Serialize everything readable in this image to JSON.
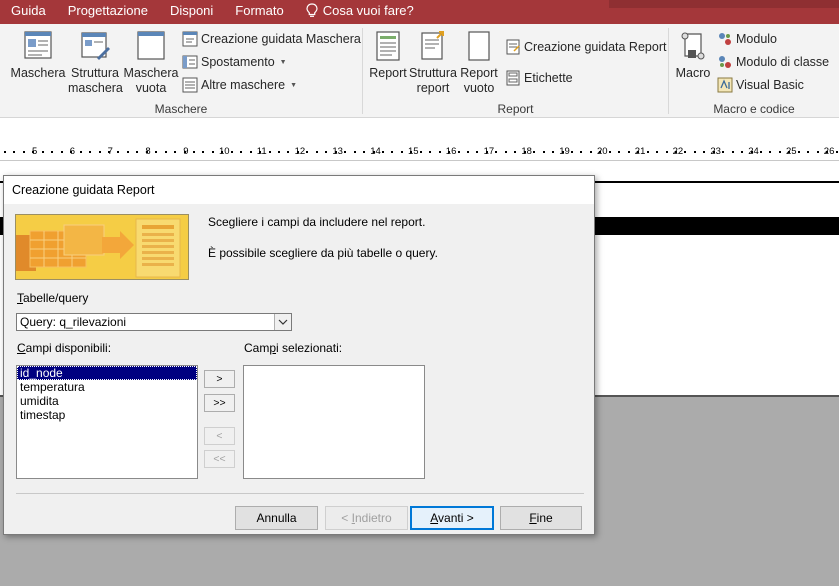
{
  "tabs": [
    "Guida",
    "Progettazione",
    "Disponi",
    "Formato"
  ],
  "tell_me": "Cosa vuoi fare?",
  "ribbon": {
    "forms_group": {
      "label": "Maschere",
      "big": [
        {
          "line1": "Maschera",
          "line2": ""
        },
        {
          "line1": "Struttura",
          "line2": "maschera"
        },
        {
          "line1": "Maschera",
          "line2": "vuota"
        }
      ],
      "small": [
        "Creazione guidata Maschera",
        "Spostamento",
        "Altre maschere"
      ]
    },
    "reports_group": {
      "label": "Report",
      "big": [
        {
          "line1": "Report",
          "line2": ""
        },
        {
          "line1": "Struttura",
          "line2": "report"
        },
        {
          "line1": "Report",
          "line2": "vuoto"
        }
      ],
      "small": [
        "Creazione guidata Report",
        "Etichette"
      ]
    },
    "macro_group": {
      "label": "Macro e codice",
      "big": [
        {
          "line1": "Macro",
          "line2": ""
        }
      ],
      "small": [
        "Modulo",
        "Modulo di classe",
        "Visual Basic"
      ]
    }
  },
  "ruler_numbers": [
    "5",
    "6",
    "7",
    "8",
    "9",
    "10",
    "11",
    "12",
    "13",
    "14",
    "15",
    "16",
    "17",
    "18",
    "19",
    "20",
    "21",
    "22",
    "23",
    "24",
    "25",
    "26"
  ],
  "dialog": {
    "title": "Creazione guidata Report",
    "intro_line1": "Scegliere i campi da includere nel report.",
    "intro_line2": "È possibile scegliere da più tabelle o query.",
    "tables_label": "Tabelle/query",
    "tables_value": "Query: q_rilevazioni",
    "available_label": "Campi disponibili:",
    "selected_label": "Campi selezionati:",
    "available_fields": [
      "id_node",
      "temperatura",
      "umidita",
      "timestap"
    ],
    "selected_fields": [],
    "move_buttons": [
      ">",
      ">>",
      "<",
      "<<"
    ],
    "buttons": {
      "cancel": "Annulla",
      "back": "< Indietro",
      "next": "Avanti >",
      "finish": "Fine"
    }
  },
  "colors": {
    "tab_bar": "#a4373a",
    "ribbon": "#f3f3f3",
    "selection": "#000080",
    "banner": "#f5d04a"
  }
}
